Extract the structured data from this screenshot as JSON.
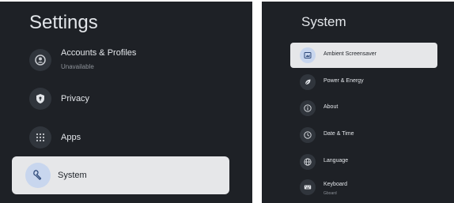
{
  "left": {
    "title": "Settings",
    "items": [
      {
        "label": "Accounts & Profiles",
        "sublabel": "Unavailable",
        "icon": "account-icon"
      },
      {
        "label": "Privacy",
        "icon": "shield-icon"
      },
      {
        "label": "Apps",
        "icon": "apps-grid-icon"
      },
      {
        "label": "System",
        "icon": "wrench-icon",
        "selected": true
      }
    ]
  },
  "right": {
    "title": "System",
    "items": [
      {
        "label": "Ambient Screensaver",
        "icon": "screensaver-icon",
        "selected": true
      },
      {
        "label": "Power & Energy",
        "icon": "power-energy-icon"
      },
      {
        "label": "About",
        "icon": "info-icon"
      },
      {
        "label": "Date & Time",
        "icon": "clock-icon"
      },
      {
        "label": "Language",
        "icon": "globe-icon"
      },
      {
        "label": "Keyboard",
        "sublabel": "Gboard",
        "icon": "keyboard-icon"
      }
    ]
  },
  "colors": {
    "panel_bg": "#1e2126",
    "selected_bg": "#e6e7e9",
    "selected_icon_bg": "#c8d6ee",
    "icon_circle": "#30353c",
    "text": "#e3e6ea",
    "subtext": "#8d9299"
  }
}
